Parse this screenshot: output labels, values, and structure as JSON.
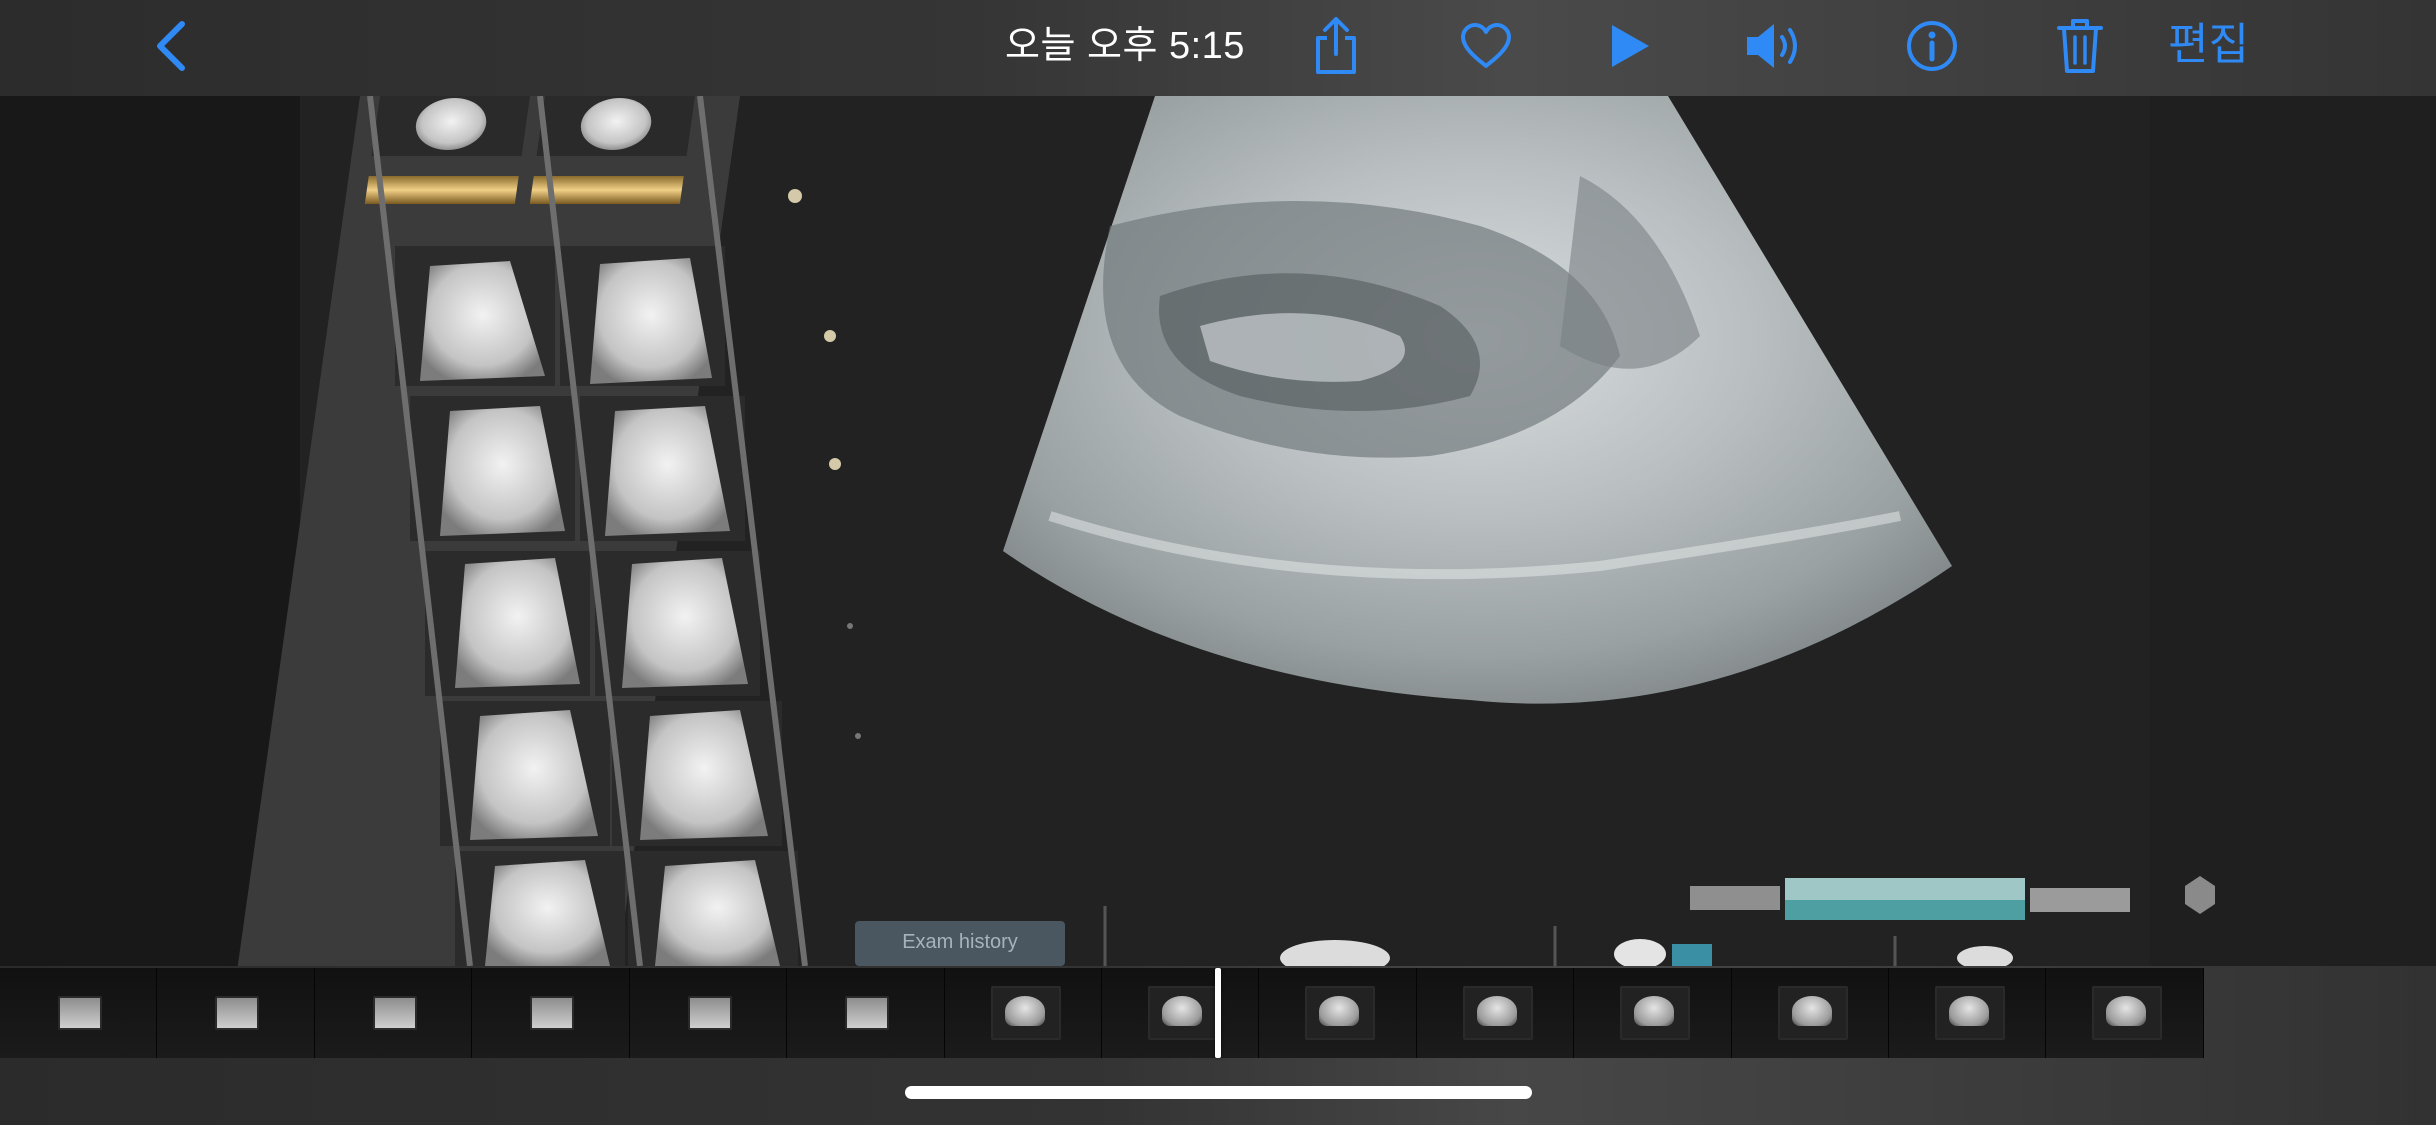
{
  "toolbar": {
    "title": "오늘 오후 5:15",
    "edit_label": "편집",
    "icons": {
      "back": "chevron-left-icon",
      "share": "share-icon",
      "favorite": "heart-icon",
      "play": "play-icon",
      "sound": "speaker-icon",
      "info": "info-icon",
      "delete": "trash-icon"
    }
  },
  "photo": {
    "panel_button_label": "Exam history",
    "description_kind": "ultrasound-video-frame"
  },
  "filmstrip": {
    "frame_count": 14
  },
  "colors": {
    "accent": "#2f8af5",
    "title": "#ffffff",
    "toolbar_bg": "#353535",
    "strip_bg": "#0c0c0c"
  }
}
